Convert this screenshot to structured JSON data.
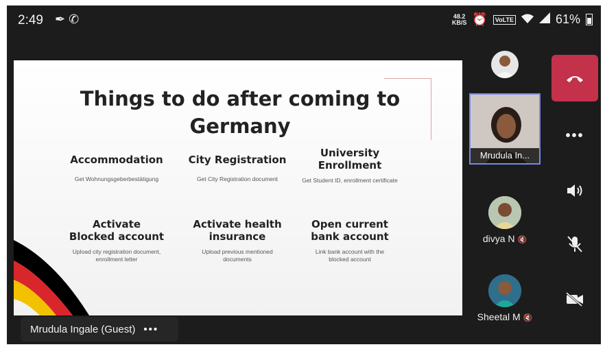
{
  "status_bar": {
    "time": "2:49",
    "net_speed_value": "48.2",
    "net_speed_unit": "KB/S",
    "volte": "VoLTE",
    "battery": "61%"
  },
  "slide": {
    "title": "Things to do after coming to Germany",
    "items": [
      {
        "title": "Accommodation",
        "sub": "Get Wohnungsgeberbestätigung"
      },
      {
        "title": "City Registration",
        "sub": "Get City Registration document"
      },
      {
        "title": "University Enrollment",
        "sub": "Get Student ID, enrollment certificate"
      },
      {
        "title": "Activate Blocked account",
        "sub": "Upload city registration document, enrollment letter"
      },
      {
        "title": "Activate health insurance",
        "sub": "Upload previous mentioned documents"
      },
      {
        "title": "Open current bank account",
        "sub": "Link bank account with the blocked account"
      }
    ],
    "ribbon_colors": [
      "#000000",
      "#d9262c",
      "#f2c100"
    ]
  },
  "presenter_chip": {
    "name": "Mrudula Ingale (Guest)",
    "more": "•••"
  },
  "participants": [
    {
      "name": "",
      "avatar_color": "#e6e6e6"
    },
    {
      "name": "Mrudula In...",
      "active": true
    },
    {
      "name": "divya N",
      "muted": true
    },
    {
      "name": "Sheetal M",
      "muted": true
    }
  ],
  "controls": {
    "end_call": "end-call-icon",
    "more": "•••",
    "speaker": "speaker-icon",
    "mic": "mic-off-icon",
    "camera": "camera-off-icon"
  },
  "colors": {
    "end_call": "#c4314b",
    "active_border": "#7a87e8",
    "background": "#1c1c1c"
  }
}
